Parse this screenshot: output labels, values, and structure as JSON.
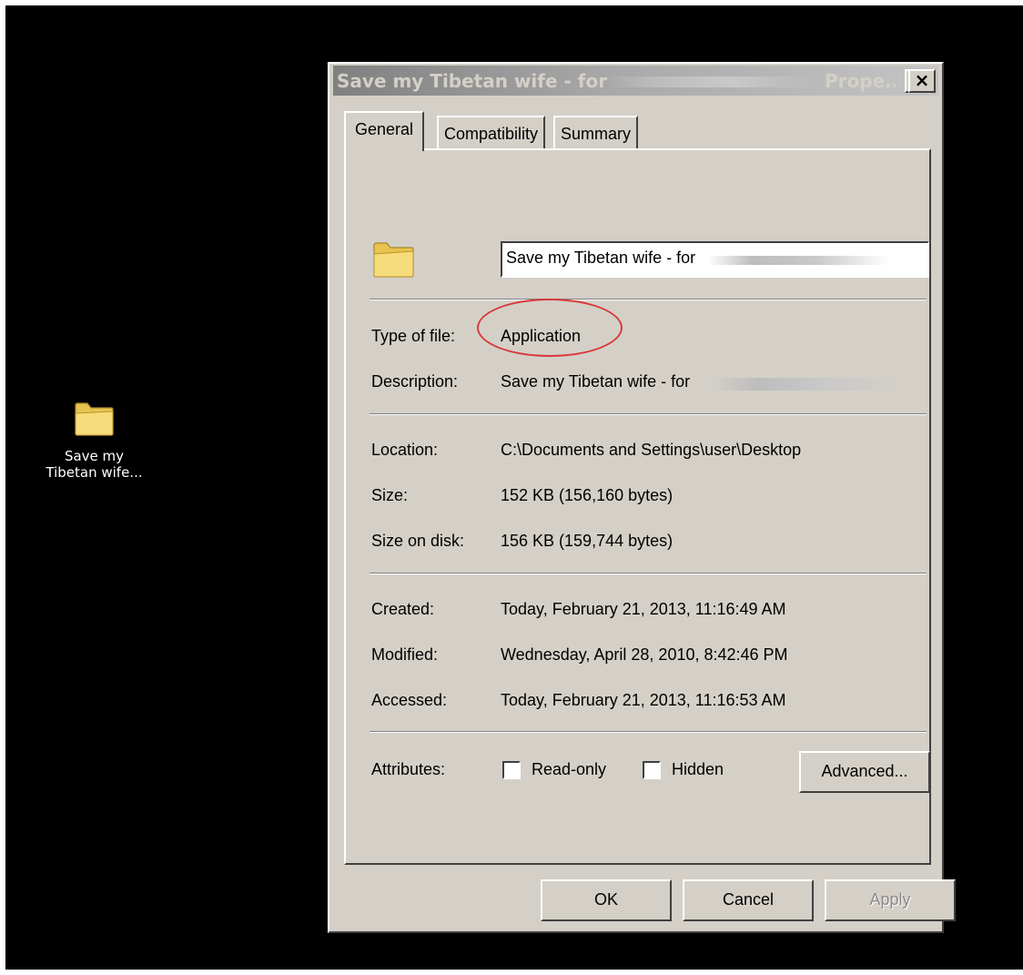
{
  "desktop": {
    "icon_label_line1": "Save my",
    "icon_label_line2": "Tibetan wife...",
    "icon_name": "folder-icon",
    "background_color": "#000000"
  },
  "dialog": {
    "title": "Save my Tibetan wife - for",
    "title_suffix": "Prope...",
    "help_label": "?",
    "close_label": "×",
    "tabs": [
      {
        "label": "General",
        "active": true
      },
      {
        "label": "Compatibility",
        "active": false
      },
      {
        "label": "Summary",
        "active": false
      }
    ],
    "general": {
      "file_icon": "folder-icon",
      "name_value": "Save my Tibetan wife - for",
      "type_label": "Type of file:",
      "type_value": "Application",
      "description_label": "Description:",
      "description_value": "Save my Tibetan wife - for",
      "location_label": "Location:",
      "location_value": "C:\\Documents and Settings\\user\\Desktop",
      "size_label": "Size:",
      "size_value": "152 KB (156,160 bytes)",
      "size_on_disk_label": "Size on disk:",
      "size_on_disk_value": "156 KB (159,744 bytes)",
      "created_label": "Created:",
      "created_value": "Today, February 21, 2013, 11:16:49 AM",
      "modified_label": "Modified:",
      "modified_value": "Wednesday, April 28, 2010, 8:42:46 PM",
      "accessed_label": "Accessed:",
      "accessed_value": "Today, February 21, 2013, 11:16:53 AM",
      "attributes_label": "Attributes:",
      "readonly_label": "Read-only",
      "readonly_checked": false,
      "hidden_label": "Hidden",
      "hidden_checked": false,
      "advanced_label": "Advanced..."
    },
    "buttons": {
      "ok_label": "OK",
      "cancel_label": "Cancel",
      "apply_label": "Apply"
    },
    "annotation_color": "#d83a3a"
  }
}
